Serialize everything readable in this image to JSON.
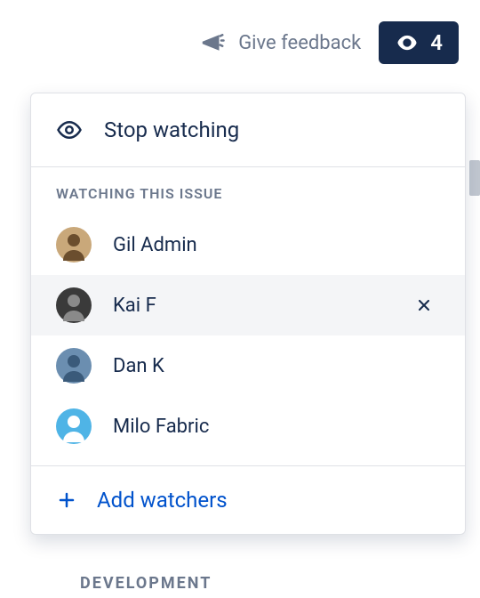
{
  "topbar": {
    "feedback_label": "Give feedback",
    "watch_count": "4"
  },
  "dropdown": {
    "stop_watching_label": "Stop watching",
    "section_header": "WATCHING THIS ISSUE",
    "add_watchers_label": "Add watchers"
  },
  "watchers": [
    {
      "name": "Gil Admin",
      "avatar_bg": "#C9A87A",
      "avatar_fg": "#6B4E2E",
      "hovered": false
    },
    {
      "name": "Kai F",
      "avatar_bg": "#3A3A3A",
      "avatar_fg": "#8A8A8A",
      "hovered": true
    },
    {
      "name": "Dan K",
      "avatar_bg": "#6B8EB0",
      "avatar_fg": "#3A5A7A",
      "hovered": false
    },
    {
      "name": "Milo Fabric",
      "avatar_bg": "#4FB4E6",
      "avatar_fg": "#FFFFFF",
      "hovered": false
    }
  ],
  "background_label": "DEVELOPMENT"
}
